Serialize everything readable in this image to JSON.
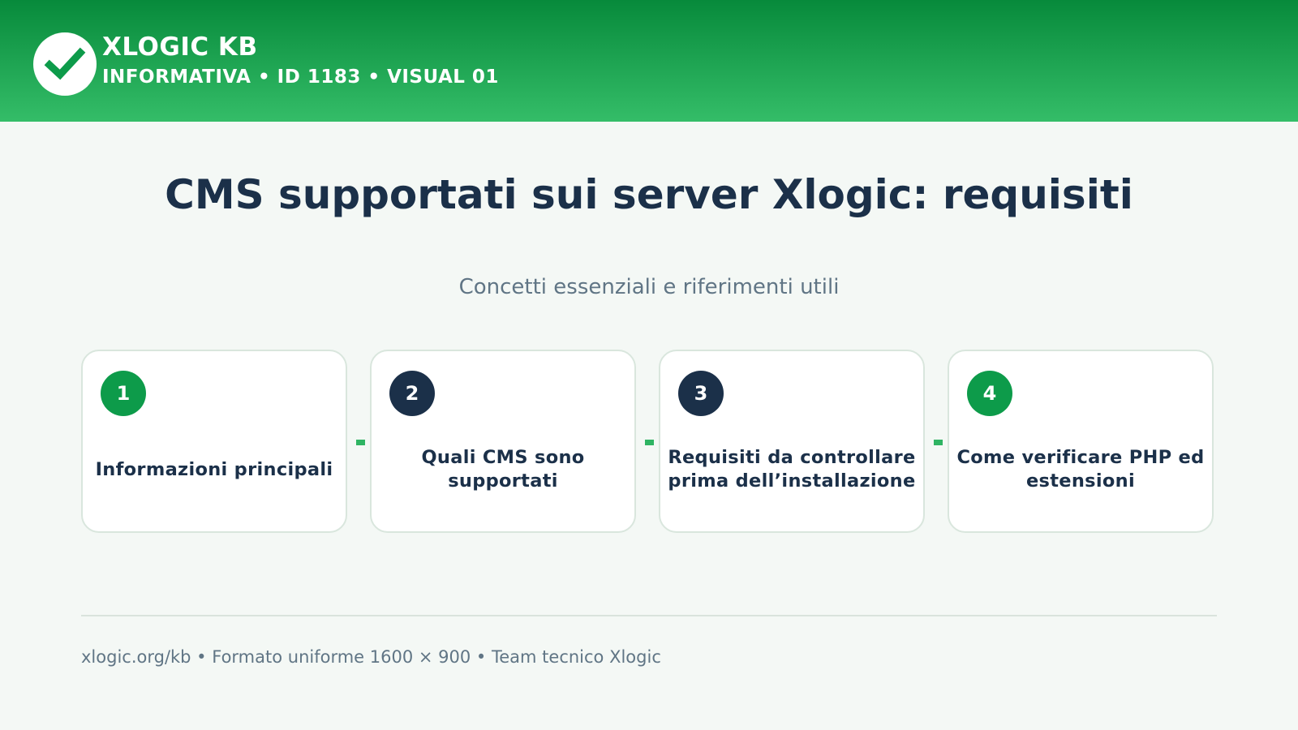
{
  "header": {
    "brand": "XLOGIC KB",
    "meta": "INFORMATIVA • ID 1183 • VISUAL 01",
    "logo_icon": "check-icon",
    "colors": {
      "header_top": "#078a3b",
      "header_bottom": "#34bd68"
    }
  },
  "main": {
    "title": "CMS supportati sui server Xlogic: requisiti",
    "subtitle": "Concetti essenziali e riferimenti utili"
  },
  "steps": [
    {
      "number": "1",
      "label": "Informazioni principali",
      "badge_color": "#0d9b4a"
    },
    {
      "number": "2",
      "label": "Quali CMS sono supportati",
      "badge_color": "#1b3049"
    },
    {
      "number": "3",
      "label": "Requisiti da controllare prima dell’installazione",
      "badge_color": "#1b3049"
    },
    {
      "number": "4",
      "label": "Come verificare PHP ed estensioni",
      "badge_color": "#0d9b4a"
    }
  ],
  "footer": {
    "text": "xlogic.org/kb • Formato uniforme 1600 × 900 • Team tecnico Xlogic"
  }
}
